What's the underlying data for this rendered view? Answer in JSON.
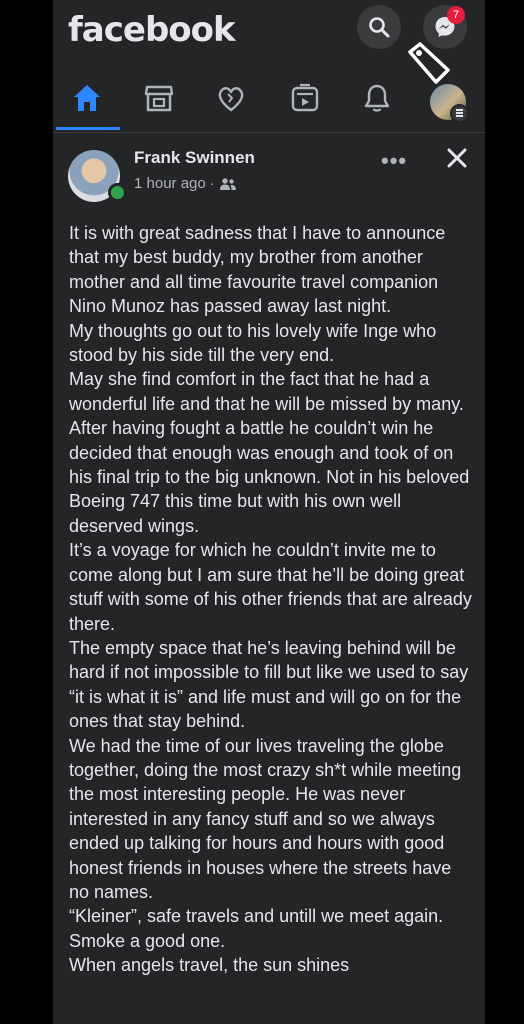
{
  "app": {
    "logo": "facebook"
  },
  "header": {
    "messenger_badge": "7"
  },
  "nav": {
    "items": [
      {
        "icon": "home-icon",
        "active": true
      },
      {
        "icon": "marketplace-icon"
      },
      {
        "icon": "dating-heart-icon"
      },
      {
        "icon": "watch-icon"
      },
      {
        "icon": "notifications-icon"
      },
      {
        "icon": "profile-menu-icon"
      }
    ]
  },
  "colors": {
    "accent": "#2d88ff",
    "badge": "#e41e3f",
    "online": "#31a24c",
    "background": "#242526"
  },
  "post": {
    "author": "Frank Swinnen",
    "time": "1 hour ago",
    "separator": "·",
    "more_label": "•••",
    "lines": [
      "It is with great sadness that I have to announce that my best buddy, my brother from another mother and all time favourite travel companion Nino Munoz has passed away last night.",
      "My thoughts go out to his lovely wife Inge who stood by his side till the very end.",
      "May she find comfort in the fact that he had a wonderful life and that he will be missed by many.",
      "After having fought a battle he couldn’t win he decided that enough was enough and took of on his final trip to the big unknown. Not in his beloved Boeing 747 this time but with his own well deserved wings.",
      "It’s a voyage for which he couldn’t invite me to come along but I am sure that he’ll be doing great stuff with some of his other friends that are already there.",
      "The empty space that he’s leaving behind will be hard if not impossible to fill but like we used to say “it is what it is” and life must and will go on for the ones that stay behind.",
      "We had the time of our lives traveling the globe together, doing the most crazy sh*t while meeting the most interesting people.  He was never interested in any fancy stuff  and so we always ended up talking for hours and hours with good honest friends in houses where the streets have no names.",
      "“Kleiner”, safe travels and untill we meet again. Smoke a good one.",
      "When angels travel, the sun shines"
    ]
  }
}
